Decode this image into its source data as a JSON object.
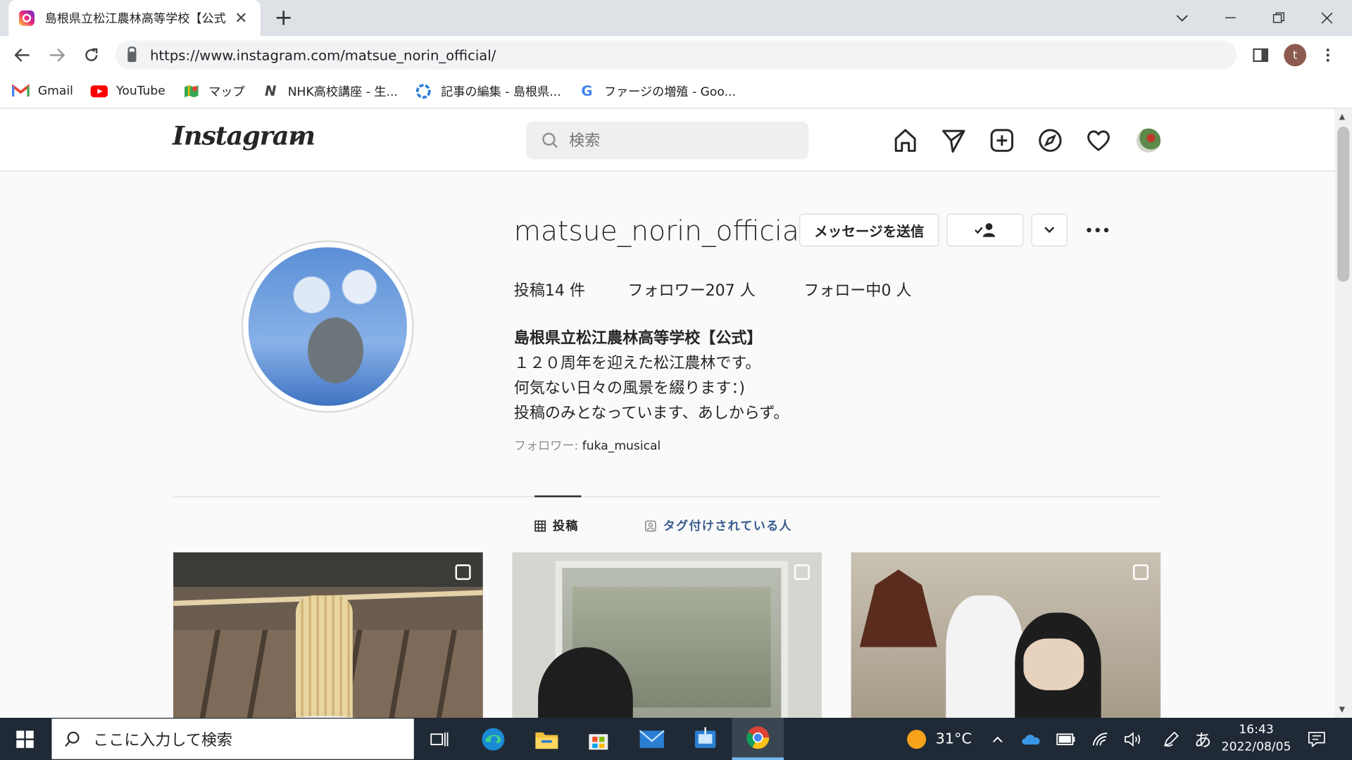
{
  "browser": {
    "tab_title": "島根県立松江農林高等学校【公式",
    "tab_close": "✕",
    "new_tab": "+",
    "url": "https://www.instagram.com/matsue_norin_official/",
    "profile_initial": "t"
  },
  "bookmarks": [
    {
      "label": "Gmail",
      "icon": "gmail-icon"
    },
    {
      "label": "YouTube",
      "icon": "youtube-icon"
    },
    {
      "label": "マップ",
      "icon": "maps-icon"
    },
    {
      "label": "NHK高校講座 - 生...",
      "icon": "nhk-icon"
    },
    {
      "label": "記事の編集 - 島根県...",
      "icon": "edit-icon"
    },
    {
      "label": "ファージの増殖 - Goo...",
      "icon": "google-icon"
    }
  ],
  "instagram": {
    "logo": "Instagram",
    "search_placeholder": "検索"
  },
  "profile": {
    "username": "matsue_norin_official",
    "message_button": "メッセージを送信",
    "stats": {
      "posts_label": "投稿",
      "posts_count": "14",
      "posts_unit": "件",
      "followers_label": "フォロワー",
      "followers_count": "207",
      "followers_unit": "人",
      "following_label": "フォロー中",
      "following_count": "0",
      "following_unit": "人"
    },
    "full_name": "島根県立松江農林高等学校【公式】",
    "bio_lines": [
      "１２０周年を迎えた松江農林です。",
      "何気ない日々の風景を綴ります：)",
      "投稿のみとなっています、あしからず。"
    ],
    "followed_by_label": "フォロワー: ",
    "followed_by_user": "fuka_musical"
  },
  "profile_tabs": {
    "posts": "投稿",
    "tagged": "タグ付けされている人"
  },
  "taskbar": {
    "search_placeholder": "ここに入力して検索",
    "weather": "31°C",
    "ime": "あ",
    "time": "16:43",
    "date": "2022/08/05"
  }
}
